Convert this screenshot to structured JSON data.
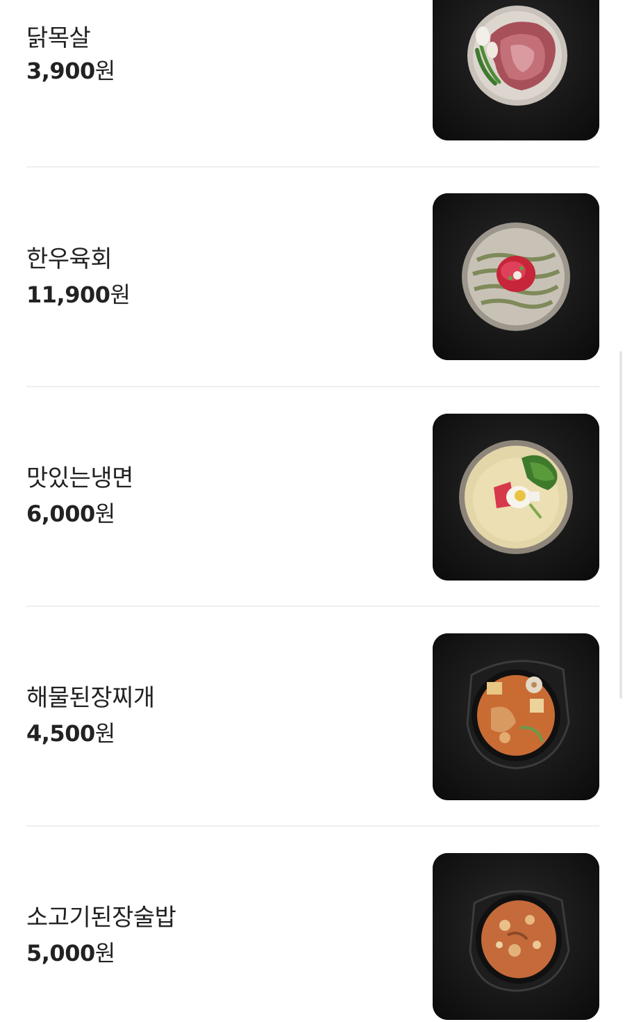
{
  "menu": {
    "items": [
      {
        "name": "닭목살",
        "price": "3,900",
        "currency": "원",
        "image": "grilled-chicken-neck-photo"
      },
      {
        "name": "한우육회",
        "price": "11,900",
        "currency": "원",
        "image": "beef-tartare-photo"
      },
      {
        "name": "맛있는냉면",
        "price": "6,000",
        "currency": "원",
        "image": "cold-noodles-photo"
      },
      {
        "name": "해물된장찌개",
        "price": "4,500",
        "currency": "원",
        "image": "seafood-doenjang-stew-photo"
      },
      {
        "name": "소고기된장술밥",
        "price": "5,000",
        "currency": "원",
        "image": "beef-doenjang-rice-stew-photo"
      }
    ]
  },
  "colors": {
    "text": "#222222",
    "divider": "#efefef",
    "thumb_background": "#161616"
  }
}
